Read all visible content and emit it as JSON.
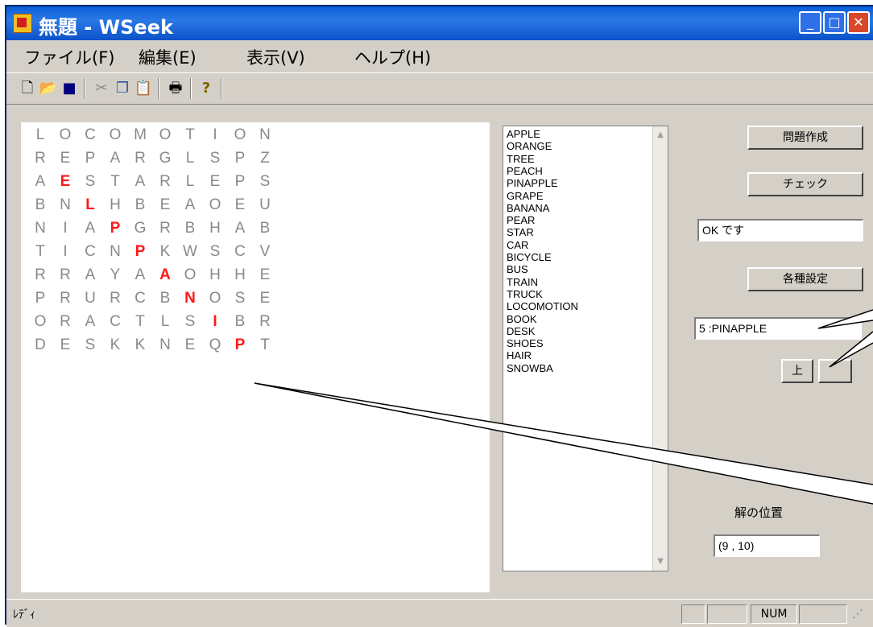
{
  "window": {
    "title": "無題 - WSeek",
    "controls": {
      "minimize": "_",
      "maximize": "□",
      "close": "✕"
    }
  },
  "menu": {
    "items": [
      "ファイル(F)",
      "編集(E)",
      "表示(V)",
      "ヘルプ(H)"
    ]
  },
  "toolbar": {
    "icons": [
      "new-file-icon",
      "open-folder-icon",
      "save-icon",
      "cut-icon",
      "copy-icon",
      "paste-icon",
      "print-icon",
      "help-icon"
    ]
  },
  "grid": {
    "rows": [
      [
        "L",
        "O",
        "C",
        "O",
        "M",
        "O",
        "T",
        "I",
        "O",
        "N"
      ],
      [
        "R",
        "E",
        "P",
        "A",
        "R",
        "G",
        "L",
        "S",
        "P",
        "Z"
      ],
      [
        "A",
        "E",
        "S",
        "T",
        "A",
        "R",
        "L",
        "E",
        "P",
        "S"
      ],
      [
        "B",
        "N",
        "L",
        "H",
        "B",
        "E",
        "A",
        "O",
        "E",
        "U"
      ],
      [
        "N",
        "I",
        "A",
        "P",
        "G",
        "R",
        "B",
        "H",
        "A",
        "B"
      ],
      [
        "T",
        "I",
        "C",
        "N",
        "P",
        "K",
        "W",
        "S",
        "C",
        "V"
      ],
      [
        "R",
        "R",
        "A",
        "Y",
        "A",
        "A",
        "O",
        "H",
        "H",
        "E"
      ],
      [
        "P",
        "R",
        "U",
        "R",
        "C",
        "B",
        "N",
        "O",
        "S",
        "E"
      ],
      [
        "O",
        "R",
        "A",
        "C",
        "T",
        "L",
        "S",
        "I",
        "B",
        "R"
      ],
      [
        "D",
        "E",
        "S",
        "K",
        "K",
        "N",
        "E",
        "Q",
        "P",
        "T"
      ]
    ],
    "highlighted": [
      [
        2,
        1
      ],
      [
        3,
        2
      ],
      [
        4,
        3
      ],
      [
        5,
        4
      ],
      [
        6,
        5
      ],
      [
        7,
        6
      ],
      [
        8,
        7
      ],
      [
        9,
        8
      ]
    ],
    "highlight_color": "#ff1818",
    "letter_color": "#8a8a8a"
  },
  "wordlist": {
    "items": [
      "APPLE",
      "ORANGE",
      "TREE",
      "PEACH",
      "PINAPPLE",
      "GRAPE",
      "BANANA",
      "PEAR",
      "STAR",
      "CAR",
      "BICYCLE",
      "BUS",
      "TRAIN",
      "TRUCK",
      "LOCOMOTION",
      "BOOK",
      "DESK",
      "SHOES",
      "HAIR",
      "SNOWBA"
    ]
  },
  "controls": {
    "create_label": "問題作成",
    "check_label": "チェック",
    "result_value": "OK です",
    "settings_label": "各種設定",
    "selected_word": "5 :PINAPPLE",
    "up_label": "上",
    "down_label": "",
    "solution_label": "解の位置",
    "solution_value": "(9 , 10)"
  },
  "statusbar": {
    "text": "ﾚﾃﾞｨ",
    "num": "NUM"
  },
  "colors": {
    "titlebar": "#0b52c9",
    "face": "#d4d0c8",
    "close": "#d9472b"
  }
}
